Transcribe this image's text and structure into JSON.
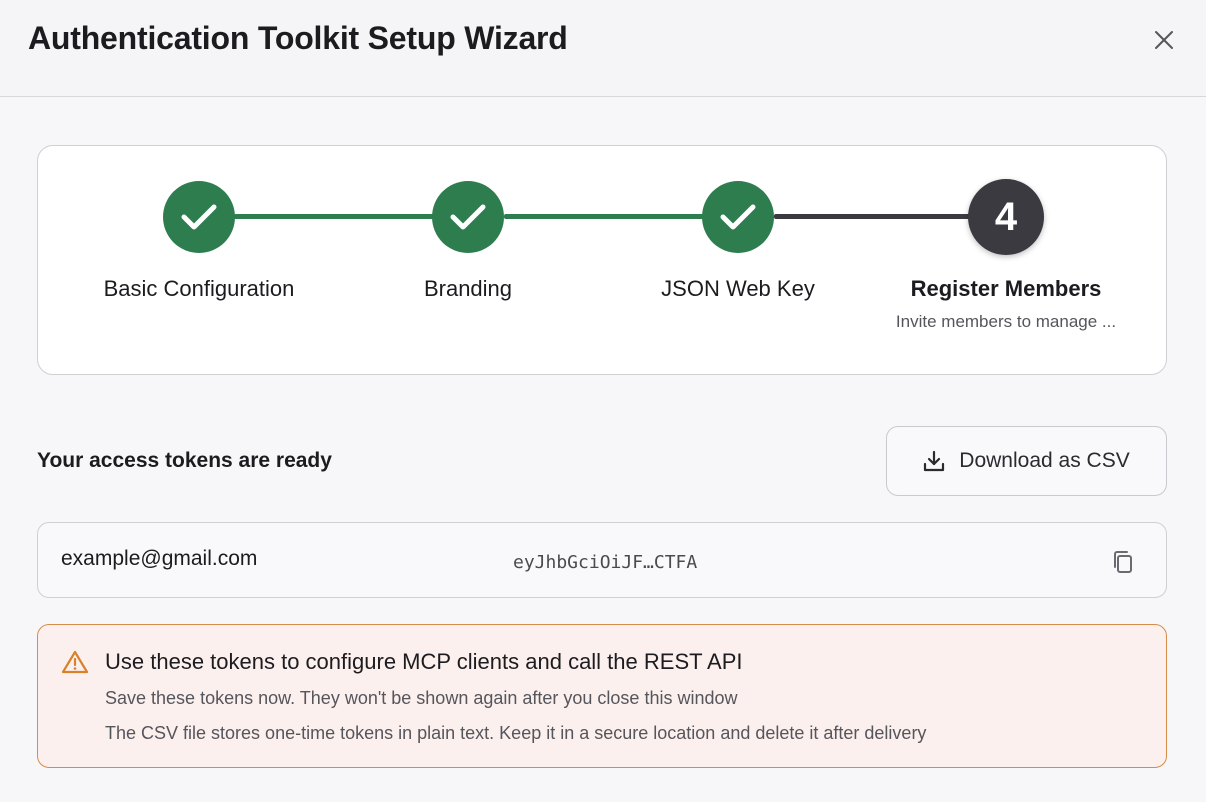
{
  "dialog": {
    "title": "Authentication Toolkit Setup Wizard",
    "close_icon": "close-icon"
  },
  "stepper": {
    "steps": [
      {
        "label": "Basic Configuration",
        "state": "done",
        "icon": "check-icon"
      },
      {
        "label": "Branding",
        "state": "done",
        "icon": "check-icon"
      },
      {
        "label": "JSON Web Key",
        "state": "done",
        "icon": "check-icon"
      },
      {
        "label": "Register Members",
        "state": "active",
        "number": "4",
        "description": "Invite members to manage ..."
      }
    ],
    "colors": {
      "done": "#2e7d4f",
      "active": "#3a3a40"
    }
  },
  "tokens": {
    "title": "Your access tokens are ready",
    "download_label": "Download as CSV",
    "download_icon": "download-icon",
    "rows": [
      {
        "email": "example@gmail.com",
        "token": "eyJhbGciOiJF…CTFA",
        "copy_icon": "copy-icon"
      }
    ]
  },
  "warning": {
    "icon": "warning-icon",
    "title": "Use these tokens to configure MCP clients and call the REST API",
    "lines": [
      "Save these tokens now. They won't be shown again after you close this window",
      "The CSV file stores one-time tokens in plain text. Keep it in a secure location and delete it after delivery"
    ],
    "colors": {
      "background": "#fcf0ee",
      "border": "#d58c48",
      "icon": "#d9822b"
    }
  }
}
